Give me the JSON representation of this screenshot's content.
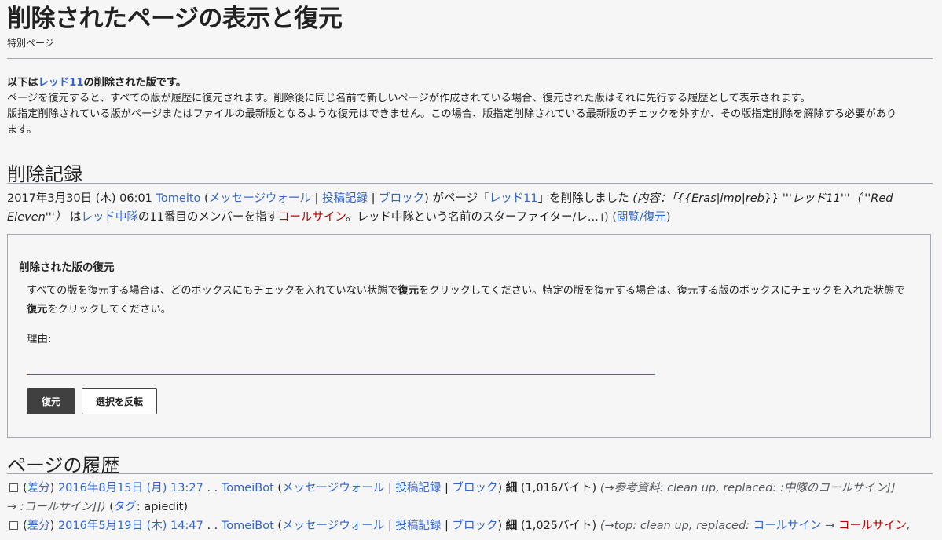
{
  "header": {
    "title": "削除されたページの表示と復元",
    "subtitle": "特別ページ"
  },
  "intro": {
    "prefix": "以下は",
    "page_link": "レッド11",
    "suffix": "の削除された版です。",
    "line2": "ページを復元すると、すべての版が履歴に復元されます。削除後に同じ名前で新しいページが作成されている場合、復元された版はそれに先行する履歴として表示されます。",
    "line3": "版指定削除されている版がページまたはファイルの最新版となるような復元はできません。この場合、版指定削除されている最新版のチェックを外すか、その版指定削除を解除する必要があり",
    "line4": "ます。"
  },
  "deletion_log": {
    "heading": "削除記録",
    "date": "2017年3月30日 (木) 06:01",
    "user": "Tomeito",
    "talk": "メッセージウォール",
    "contribs": "投稿記録",
    "block": "ブロック",
    "action_pre": "がページ「",
    "page": "レッド11",
    "action_post": "」を削除しました",
    "summary_pre": "(内容：「",
    "template_text": "{{Eras|imp|reb}} '''レッド11'''（'''Red",
    "template_text2": "Eleven'''）",
    "wa": "は",
    "link_red_squadron": "レッド中隊",
    "num_member": "の11番目のメンバーを指す",
    "link_callsign": "コールサイン",
    "rest": "。レッド中隊という名前のスターファイター/レ...」)",
    "view_restore": "閲覧/復元"
  },
  "restore_box": {
    "legend": "削除された版の復元",
    "text1_a": "すべての版を復元する場合は、どのボックスにもチェックを入れていない状態で",
    "text1_b": "復元",
    "text1_c": "をクリックしてください。特定の版を復元する場合は、復元する版のボックスにチェックを入れた状態で",
    "text2_a": "復元",
    "text2_b": "をクリックしてください。",
    "reason_label": "理由:",
    "reason_value": "",
    "restore_button": "復元",
    "invert_button": "選択を反転"
  },
  "history": {
    "heading": "ページの履歴",
    "rows": [
      {
        "diff": "差分",
        "date": "2016年8月15日 (月) 13:27",
        "user": "TomeiBot",
        "talk": "メッセージウォール",
        "contribs": "投稿記録",
        "block": "ブロック",
        "minor": "細",
        "size": "(1,016バイト)",
        "summary": "(→参考資料: clean up, replaced: :中隊のコールサイン]]",
        "summary2": "→ :コールサイン]])",
        "tag_label": "タグ",
        "tag": "apiedit"
      },
      {
        "diff": "差分",
        "date": "2016年5月19日 (木) 14:47",
        "user": "TomeiBot",
        "talk": "メッセージウォール",
        "contribs": "投稿記録",
        "block": "ブロック",
        "minor": "細",
        "size": "(1,025バイト)",
        "summary_pre": "(→top: clean up, replaced: ",
        "summary_link1": "コールサイン",
        "summary_arrow": " → ",
        "summary_link2": "コールサイン",
        "summary_post": ","
      }
    ]
  }
}
